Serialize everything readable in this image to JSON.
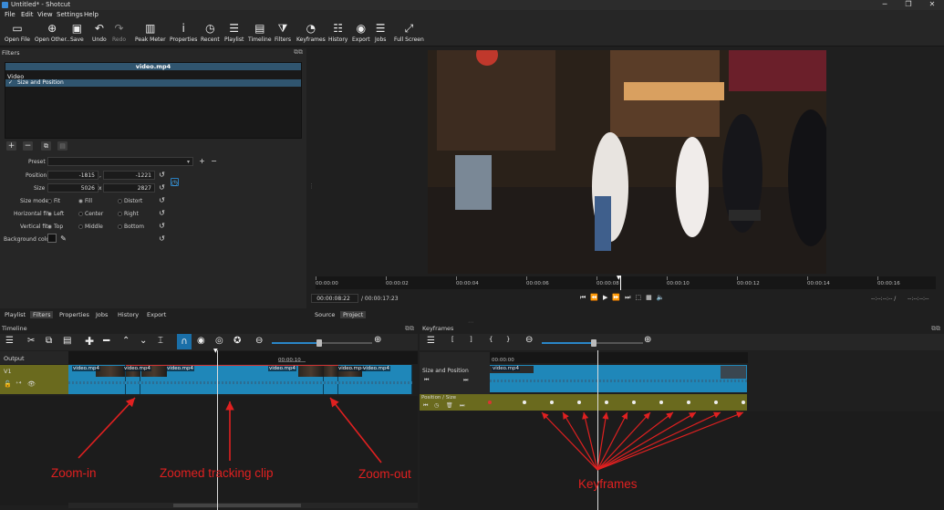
{
  "window": {
    "title": "Untitled* - Shotcut",
    "controls": [
      "─",
      "❐",
      "✕"
    ]
  },
  "menu": [
    "File",
    "Edit",
    "View",
    "Settings",
    "Help"
  ],
  "toolbar": [
    {
      "label": "Open File",
      "icon": "folder-icon",
      "glyph": "▭"
    },
    {
      "label": "Open Other..",
      "icon": "open-other-icon",
      "glyph": "⊕"
    },
    {
      "label": "Save",
      "icon": "save-icon",
      "glyph": "▣"
    },
    {
      "label": "Undo",
      "icon": "undo-icon",
      "glyph": "↶"
    },
    {
      "label": "Redo",
      "icon": "redo-icon",
      "glyph": "↷",
      "disabled": true
    },
    {
      "label": "Peak Meter",
      "icon": "peak-meter-icon",
      "glyph": "▥"
    },
    {
      "label": "Properties",
      "icon": "properties-icon",
      "glyph": "ⅰ"
    },
    {
      "label": "Recent",
      "icon": "recent-icon",
      "glyph": "◷"
    },
    {
      "label": "Playlist",
      "icon": "playlist-icon",
      "glyph": "☰"
    },
    {
      "label": "Timeline",
      "icon": "timeline-icon",
      "glyph": "▤"
    },
    {
      "label": "Filters",
      "icon": "filters-icon",
      "glyph": "⧩"
    },
    {
      "label": "Keyframes",
      "icon": "keyframes-icon",
      "glyph": "◔"
    },
    {
      "label": "History",
      "icon": "history-icon",
      "glyph": "☷"
    },
    {
      "label": "Export",
      "icon": "export-icon",
      "glyph": "◉"
    },
    {
      "label": "Jobs",
      "icon": "jobs-icon",
      "glyph": "☰"
    },
    {
      "label": "Full Screen",
      "icon": "fullscreen-icon",
      "glyph": "⤢"
    }
  ],
  "filters": {
    "panel_title": "Filters",
    "clip_name": "video.mp4",
    "category": "Video",
    "items": [
      {
        "label": "Size and Position",
        "checked": true
      }
    ],
    "preset_label": "Preset",
    "position_label": "Position",
    "position_x": "-1815",
    "position_y": "-1221",
    "position_sep": ",",
    "size_label": "Size",
    "size_w": "5026",
    "size_h": "2827",
    "size_sep": "x",
    "size_mode_label": "Size mode",
    "size_mode_options": [
      "Fit",
      "Fill",
      "Distort"
    ],
    "size_mode_selected": "Fill",
    "hfit_label": "Horizontal fit",
    "hfit_options": [
      "Left",
      "Center",
      "Right"
    ],
    "hfit_selected": "Left",
    "vfit_label": "Vertical fit",
    "vfit_options": [
      "Top",
      "Middle",
      "Bottom"
    ],
    "vfit_selected": "Top",
    "bg_label": "Background color"
  },
  "player": {
    "ruler_labels": [
      "00:00:00",
      "00:00:02",
      "00:00:04",
      "00:00:06",
      "00:00:08",
      "00:00:10",
      "00:00:12",
      "00:00:14",
      "00:00:16"
    ],
    "current_time": "00:00:08:22",
    "total_time": "/ 00:00:17:23",
    "in_point": "--:--:--:-- /",
    "out_point": "--:--:--:--",
    "tabs": [
      "Source",
      "Project"
    ],
    "active_tab": "Project"
  },
  "bottom_tabs": [
    "Playlist",
    "Filters",
    "Properties",
    "Jobs",
    "History",
    "Export"
  ],
  "bottom_tab_active": "Filters",
  "timeline": {
    "title": "Timeline",
    "output_label": "Output",
    "track_name": "V1",
    "ruler_label": "00:00:10",
    "clip_labels": [
      "video.mp4",
      "video.mp4",
      "video.mp4",
      "video.mp4",
      "video.mp4",
      "video.mp4",
      "video.mp4"
    ],
    "accent": "#1a8cc4"
  },
  "keyframes": {
    "title": "Keyframes",
    "ruler_label": "00:00:00",
    "filter_row": "Size and Position",
    "param_row": "Position / Size",
    "clip_label": "video.mp4",
    "keyframe_count": 10,
    "track_color": "#6a6a1e"
  },
  "annotations": {
    "zoom_in": "Zoom-in",
    "tracking": "Zoomed tracking clip",
    "zoom_out": "Zoom-out",
    "keyframes": "Keyframes",
    "color": "#e02020"
  }
}
